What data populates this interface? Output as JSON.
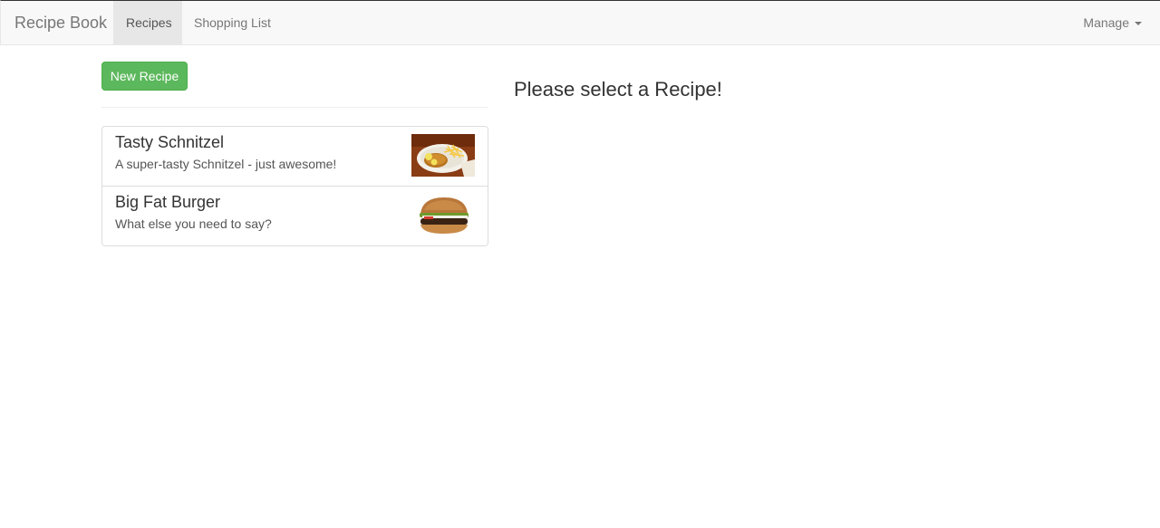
{
  "navbar": {
    "brand": "Recipe Book",
    "links": [
      {
        "label": "Recipes",
        "active": true
      },
      {
        "label": "Shopping List",
        "active": false
      }
    ],
    "manage_label": "Manage"
  },
  "recipe_list": {
    "new_button_label": "New Recipe",
    "items": [
      {
        "title": "Tasty Schnitzel",
        "description": "A super-tasty Schnitzel - just awesome!",
        "image": "schnitzel-with-fries"
      },
      {
        "title": "Big Fat Burger",
        "description": "What else you need to say?",
        "image": "burger"
      }
    ]
  },
  "detail": {
    "placeholder": "Please select a Recipe!"
  },
  "colors": {
    "accent_green": "#5cb85c",
    "navbar_bg": "#f8f8f8",
    "active_tab_bg": "#e7e7e7"
  }
}
